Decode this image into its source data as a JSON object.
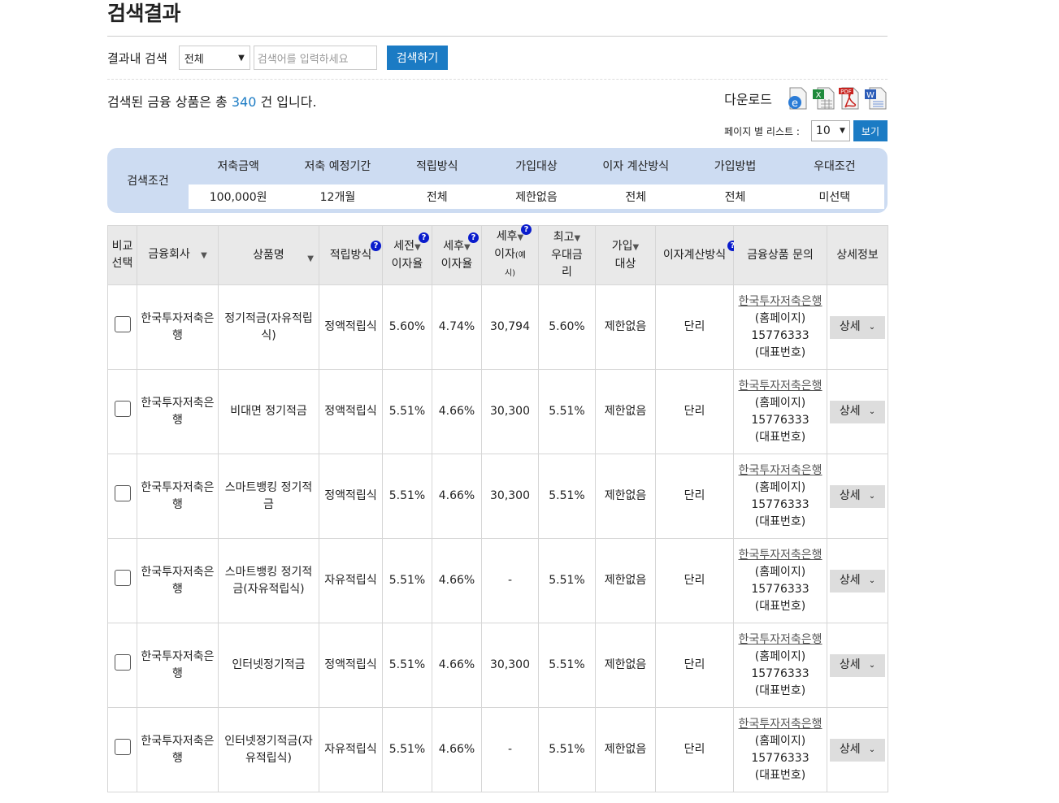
{
  "page_title": "검색결과",
  "search": {
    "label": "결과내 검색",
    "select_value": "전체",
    "placeholder": "검색어를 입력하세요",
    "button": "검색하기"
  },
  "summary": {
    "prefix": "검색된 금융 상품은 총",
    "count": "340",
    "suffix": "건 입니다."
  },
  "download": {
    "label": "다운로드",
    "icons": [
      "ie-icon",
      "excel-icon",
      "pdf-icon",
      "word-icon"
    ]
  },
  "per_page": {
    "label": "페이지 별 리스트 :",
    "value": "10",
    "button": "보기"
  },
  "conditions": {
    "label": "검색조건",
    "headers": [
      "저축금액",
      "저축 예정기간",
      "적립방식",
      "가입대상",
      "이자 계산방식",
      "가입방법",
      "우대조건"
    ],
    "values": [
      "100,000원",
      "12개월",
      "전체",
      "제한없음",
      "전체",
      "전체",
      "미선택"
    ]
  },
  "table": {
    "headers": {
      "compare": [
        "비교",
        "선택"
      ],
      "company": "금융회사",
      "product": "상품명",
      "method": "적립방식",
      "pretax": [
        "세전",
        "이자율"
      ],
      "aftertax": [
        "세후",
        "이자율"
      ],
      "interest": [
        "세후",
        "이자",
        "(예",
        "시)"
      ],
      "max_rate": [
        "최고",
        "우대금",
        "리"
      ],
      "target": [
        "가입",
        "대상"
      ],
      "calc": "이자계산방식",
      "inquiry": "금융상품 문의",
      "detail": "상세정보"
    },
    "rows": [
      {
        "company": "한국투자저축은행",
        "product": "정기적금(자유적립식)",
        "method": "정액적립식",
        "pretax": "5.60%",
        "aftertax": "4.74%",
        "interest": "30,794",
        "max": "5.60%",
        "target": "제한없음",
        "calc": "단리",
        "inq_link": "한국투자저축은행",
        "inq_home": "(홈페이지)",
        "inq_phone": "15776333",
        "inq_rep": "(대표번호)",
        "detail": "상세"
      },
      {
        "company": "한국투자저축은행",
        "product": "비대면 정기적금",
        "method": "정액적립식",
        "pretax": "5.51%",
        "aftertax": "4.66%",
        "interest": "30,300",
        "max": "5.51%",
        "target": "제한없음",
        "calc": "단리",
        "inq_link": "한국투자저축은행",
        "inq_home": "(홈페이지)",
        "inq_phone": "15776333",
        "inq_rep": "(대표번호)",
        "detail": "상세"
      },
      {
        "company": "한국투자저축은행",
        "product": "스마트뱅킹 정기적금",
        "method": "정액적립식",
        "pretax": "5.51%",
        "aftertax": "4.66%",
        "interest": "30,300",
        "max": "5.51%",
        "target": "제한없음",
        "calc": "단리",
        "inq_link": "한국투자저축은행",
        "inq_home": "(홈페이지)",
        "inq_phone": "15776333",
        "inq_rep": "(대표번호)",
        "detail": "상세"
      },
      {
        "company": "한국투자저축은행",
        "product": "스마트뱅킹 정기적금(자유적립식)",
        "method": "자유적립식",
        "pretax": "5.51%",
        "aftertax": "4.66%",
        "interest": "-",
        "max": "5.51%",
        "target": "제한없음",
        "calc": "단리",
        "inq_link": "한국투자저축은행",
        "inq_home": "(홈페이지)",
        "inq_phone": "15776333",
        "inq_rep": "(대표번호)",
        "detail": "상세"
      },
      {
        "company": "한국투자저축은행",
        "product": "인터넷정기적금",
        "method": "정액적립식",
        "pretax": "5.51%",
        "aftertax": "4.66%",
        "interest": "30,300",
        "max": "5.51%",
        "target": "제한없음",
        "calc": "단리",
        "inq_link": "한국투자저축은행",
        "inq_home": "(홈페이지)",
        "inq_phone": "15776333",
        "inq_rep": "(대표번호)",
        "detail": "상세"
      },
      {
        "company": "한국투자저축은행",
        "product": "인터넷정기적금(자유적립식)",
        "method": "자유적립식",
        "pretax": "5.51%",
        "aftertax": "4.66%",
        "interest": "-",
        "max": "5.51%",
        "target": "제한없음",
        "calc": "단리",
        "inq_link": "한국투자저축은행",
        "inq_home": "(홈페이지)",
        "inq_phone": "15776333",
        "inq_rep": "(대표번호)",
        "detail": "상세"
      }
    ]
  }
}
